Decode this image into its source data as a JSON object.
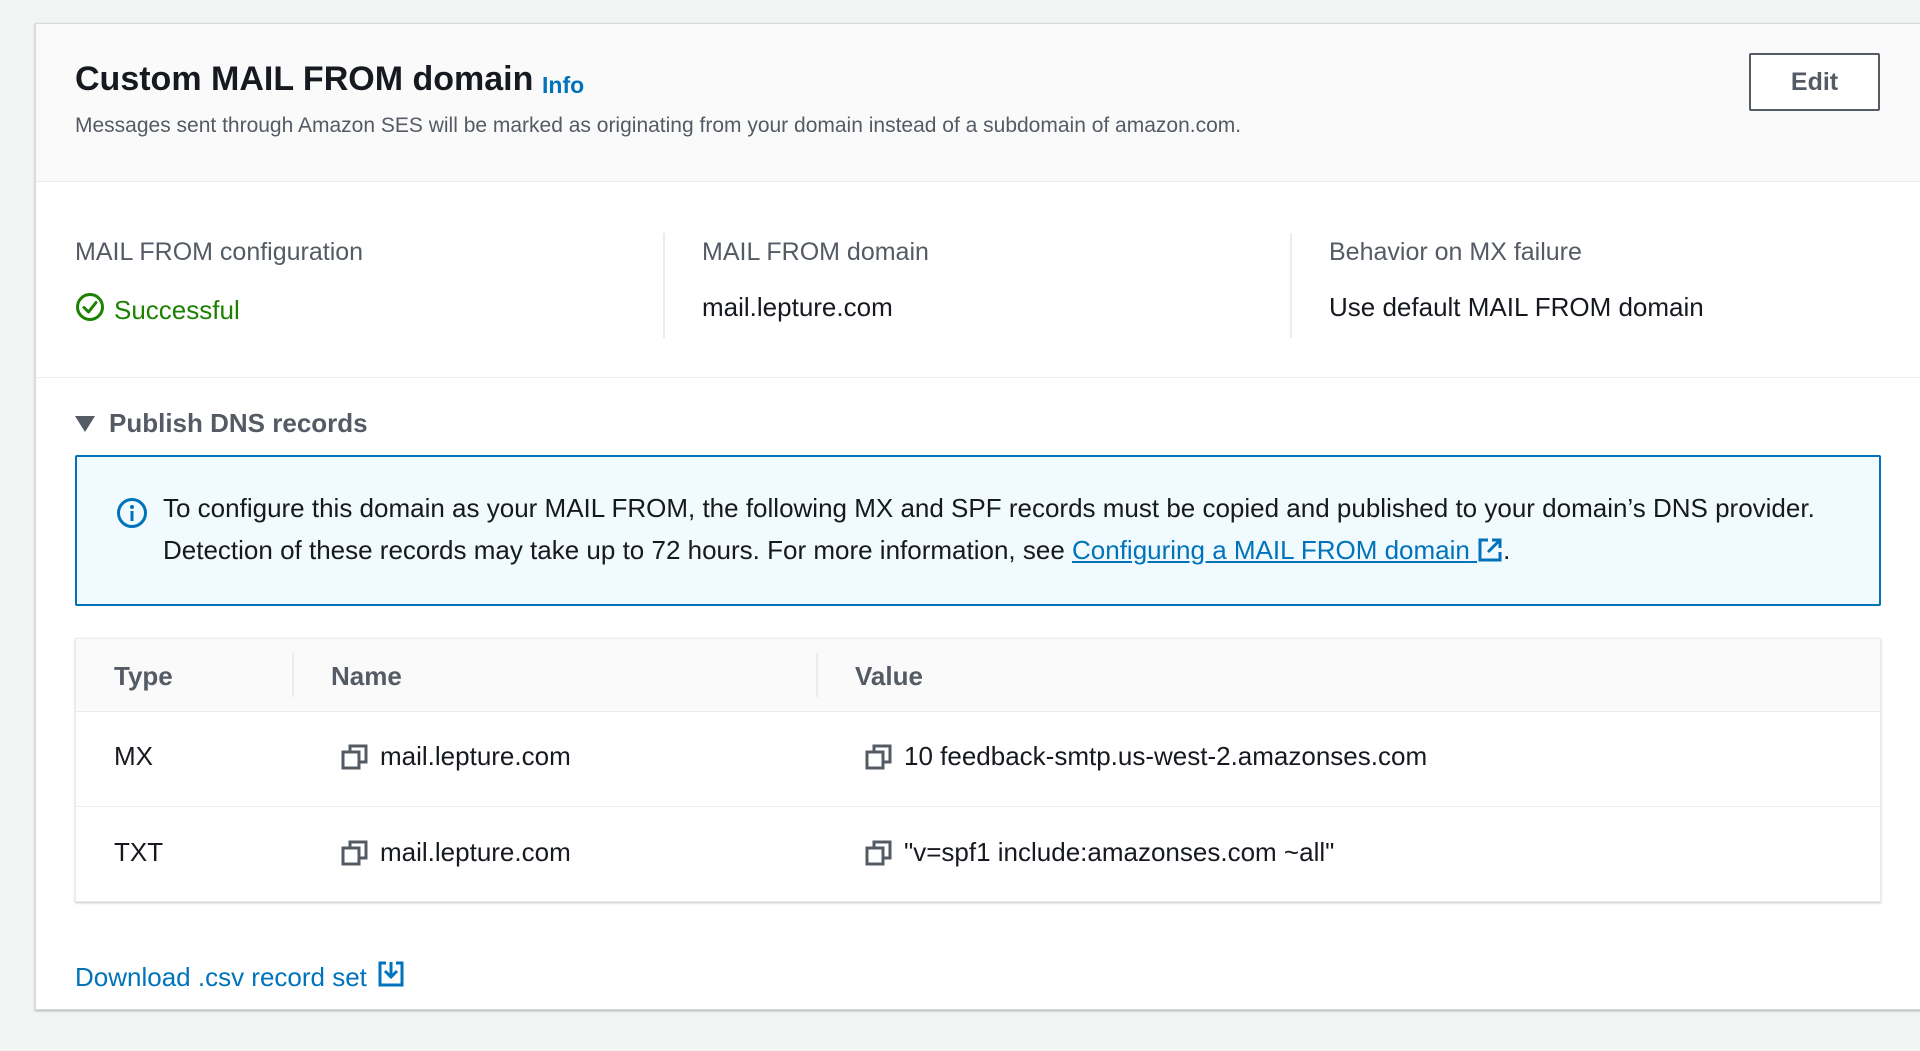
{
  "header": {
    "title": "Custom MAIL FROM domain",
    "info_label": "Info",
    "description": "Messages sent through Amazon SES will be marked as originating from your domain instead of a subdomain of amazon.com.",
    "edit_label": "Edit"
  },
  "summary": {
    "configuration": {
      "label": "MAIL FROM configuration",
      "value": "Successful",
      "status_color": "#1d8102"
    },
    "domain": {
      "label": "MAIL FROM domain",
      "value": "mail.lepture.com"
    },
    "behavior": {
      "label": "Behavior on MX failure",
      "value": "Use default MAIL FROM domain"
    }
  },
  "dns_section": {
    "toggle_label": "Publish DNS records",
    "alert": {
      "text": "To configure this domain as your MAIL FROM, the following MX and SPF records must be copied and published to your domain’s DNS provider. Detection of these records may take up to 72 hours. For more information, see ",
      "link_text": "Configuring a MAIL FROM domain",
      "suffix": "."
    },
    "table": {
      "columns": [
        "Type",
        "Name",
        "Value"
      ],
      "rows": [
        {
          "type": "MX",
          "name": "mail.lepture.com",
          "value": "10 feedback-smtp.us-west-2.amazonses.com"
        },
        {
          "type": "TXT",
          "name": "mail.lepture.com",
          "value": "\"v=spf1 include:amazonses.com ~all\""
        }
      ]
    },
    "download_label": "Download .csv record set"
  },
  "colors": {
    "link": "#0073bb",
    "alert_background": "#f1faff",
    "success": "#1d8102"
  }
}
